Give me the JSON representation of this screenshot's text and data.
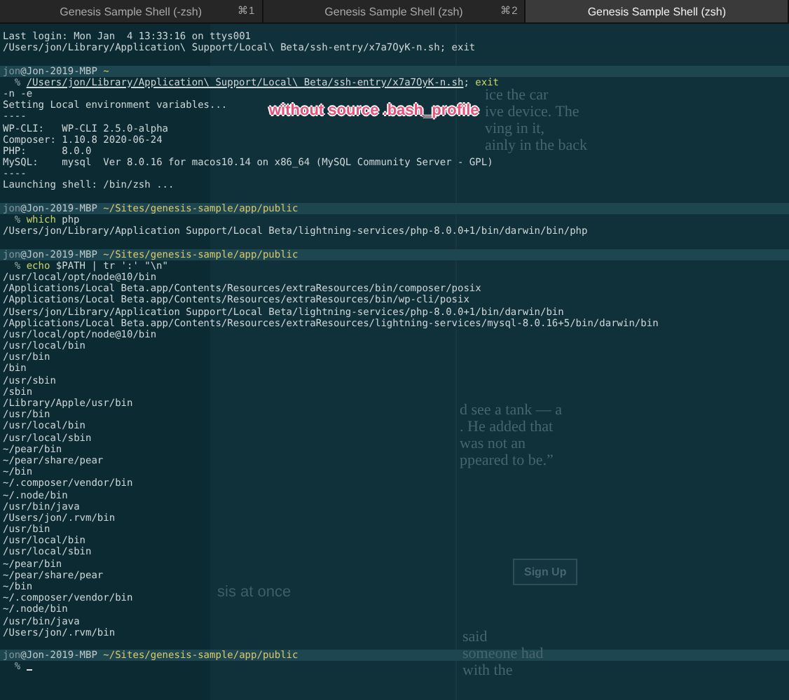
{
  "tabs": [
    {
      "title": "Genesis Sample Shell (-zsh)",
      "shortcut": "⌘1",
      "selected": false
    },
    {
      "title": "Genesis Sample Shell (zsh)",
      "shortcut": "⌘2",
      "selected": false
    },
    {
      "title": "Genesis Sample Shell (zsh)",
      "selected": true
    }
  ],
  "terminal_lines": [
    {
      "kind": "output",
      "text": "Last login: Mon Jan  4 13:33:16 on ttys001"
    },
    {
      "kind": "output",
      "text": "/Users/jon/Library/Application\\ Support/Local\\ Beta/ssh-entry/x7a7OyK-n.sh; exit"
    },
    {
      "kind": "blank"
    },
    {
      "kind": "prompt",
      "user": "jon",
      "host": "@Jon-2019-MBP",
      "path": "~"
    },
    {
      "kind": "command",
      "symbol": "%",
      "parts": [
        {
          "kind": "path",
          "text": "/Users/jon/Library/Application\\ Support/Local\\ Beta/ssh-entry/x7a7OyK-n.sh"
        },
        {
          "kind": "plain",
          "text": ";"
        },
        {
          "kind": "keyword",
          "text": "exit",
          "space": true
        }
      ]
    },
    {
      "kind": "output",
      "text": "-n -e"
    },
    {
      "kind": "output",
      "text": "Setting Local environment variables..."
    },
    {
      "kind": "output",
      "text": "----"
    },
    {
      "kind": "output",
      "text": "WP-CLI:   WP-CLI 2.5.0-alpha"
    },
    {
      "kind": "output",
      "text": "Composer: 1.10.8 2020-06-24"
    },
    {
      "kind": "output",
      "text": "PHP:      8.0.0"
    },
    {
      "kind": "output",
      "text": "MySQL:    mysql  Ver 8.0.16 for macos10.14 on x86_64 (MySQL Community Server - GPL)"
    },
    {
      "kind": "output",
      "text": "----"
    },
    {
      "kind": "output",
      "text": "Launching shell: /bin/zsh ..."
    },
    {
      "kind": "blank"
    },
    {
      "kind": "prompt",
      "user": "jon",
      "host": "@Jon-2019-MBP",
      "path": "~/Sites/genesis-sample/app/public"
    },
    {
      "kind": "command",
      "symbol": "%",
      "parts": [
        {
          "kind": "keyword",
          "text": "which"
        },
        {
          "kind": "plain",
          "text": "php",
          "space": true
        }
      ]
    },
    {
      "kind": "output",
      "text": "/Users/jon/Library/Application Support/Local Beta/lightning-services/php-8.0.0+1/bin/darwin/bin/php"
    },
    {
      "kind": "blank"
    },
    {
      "kind": "prompt",
      "user": "jon",
      "host": "@Jon-2019-MBP",
      "path": "~/Sites/genesis-sample/app/public"
    },
    {
      "kind": "command",
      "symbol": "%",
      "parts": [
        {
          "kind": "keyword",
          "text": "echo"
        },
        {
          "kind": "plain",
          "text": "$PATH | tr ':' \"\\n\"",
          "space": true
        }
      ]
    },
    {
      "kind": "output",
      "text": "/usr/local/opt/node@10/bin"
    },
    {
      "kind": "output",
      "text": "/Applications/Local Beta.app/Contents/Resources/extraResources/bin/composer/posix"
    },
    {
      "kind": "output",
      "text": "/Applications/Local Beta.app/Contents/Resources/extraResources/bin/wp-cli/posix"
    },
    {
      "kind": "output",
      "text": "/Users/jon/Library/Application Support/Local Beta/lightning-services/php-8.0.0+1/bin/darwin/bin"
    },
    {
      "kind": "output",
      "text": "/Applications/Local Beta.app/Contents/Resources/extraResources/lightning-services/mysql-8.0.16+5/bin/darwin/bin"
    },
    {
      "kind": "output",
      "text": "/usr/local/opt/node@10/bin"
    },
    {
      "kind": "output",
      "text": "/usr/local/bin"
    },
    {
      "kind": "output",
      "text": "/usr/bin"
    },
    {
      "kind": "output",
      "text": "/bin"
    },
    {
      "kind": "output",
      "text": "/usr/sbin"
    },
    {
      "kind": "output",
      "text": "/sbin"
    },
    {
      "kind": "output",
      "text": "/Library/Apple/usr/bin"
    },
    {
      "kind": "output",
      "text": "/usr/bin"
    },
    {
      "kind": "output",
      "text": "/usr/local/bin"
    },
    {
      "kind": "output",
      "text": "/usr/local/sbin"
    },
    {
      "kind": "output",
      "text": "~/pear/bin"
    },
    {
      "kind": "output",
      "text": "~/pear/share/pear"
    },
    {
      "kind": "output",
      "text": "~/bin"
    },
    {
      "kind": "output",
      "text": "~/.composer/vendor/bin"
    },
    {
      "kind": "output",
      "text": "~/.node/bin"
    },
    {
      "kind": "output",
      "text": "/usr/bin/java"
    },
    {
      "kind": "output",
      "text": "/Users/jon/.rvm/bin"
    },
    {
      "kind": "output",
      "text": "/usr/bin"
    },
    {
      "kind": "output",
      "text": "/usr/local/bin"
    },
    {
      "kind": "output",
      "text": "/usr/local/sbin"
    },
    {
      "kind": "output",
      "text": "~/pear/bin"
    },
    {
      "kind": "output",
      "text": "~/pear/share/pear"
    },
    {
      "kind": "output",
      "text": "~/bin"
    },
    {
      "kind": "output",
      "text": "~/.composer/vendor/bin"
    },
    {
      "kind": "output",
      "text": "~/.node/bin"
    },
    {
      "kind": "output",
      "text": "/usr/bin/java"
    },
    {
      "kind": "output",
      "text": "/Users/jon/.rvm/bin"
    },
    {
      "kind": "blank"
    },
    {
      "kind": "prompt",
      "user": "jon",
      "host": "@Jon-2019-MBP",
      "path": "~/Sites/genesis-sample/app/public"
    },
    {
      "kind": "command",
      "symbol": "%",
      "cursor": true
    }
  ],
  "annotation": "without source .bash_profile",
  "background_page": {
    "article_top": [
      "ice the car",
      "ive device. The",
      "ving in it,",
      "ainly in the back"
    ],
    "article_middle": [
      "d see a tank — a",
      ". He added that",
      "was not an",
      "ppeared to be.”"
    ],
    "article_bottom": [
      "said",
      "someone had",
      "with the"
    ],
    "notice_title": "sis at once",
    "signup_button": "Sign Up"
  }
}
